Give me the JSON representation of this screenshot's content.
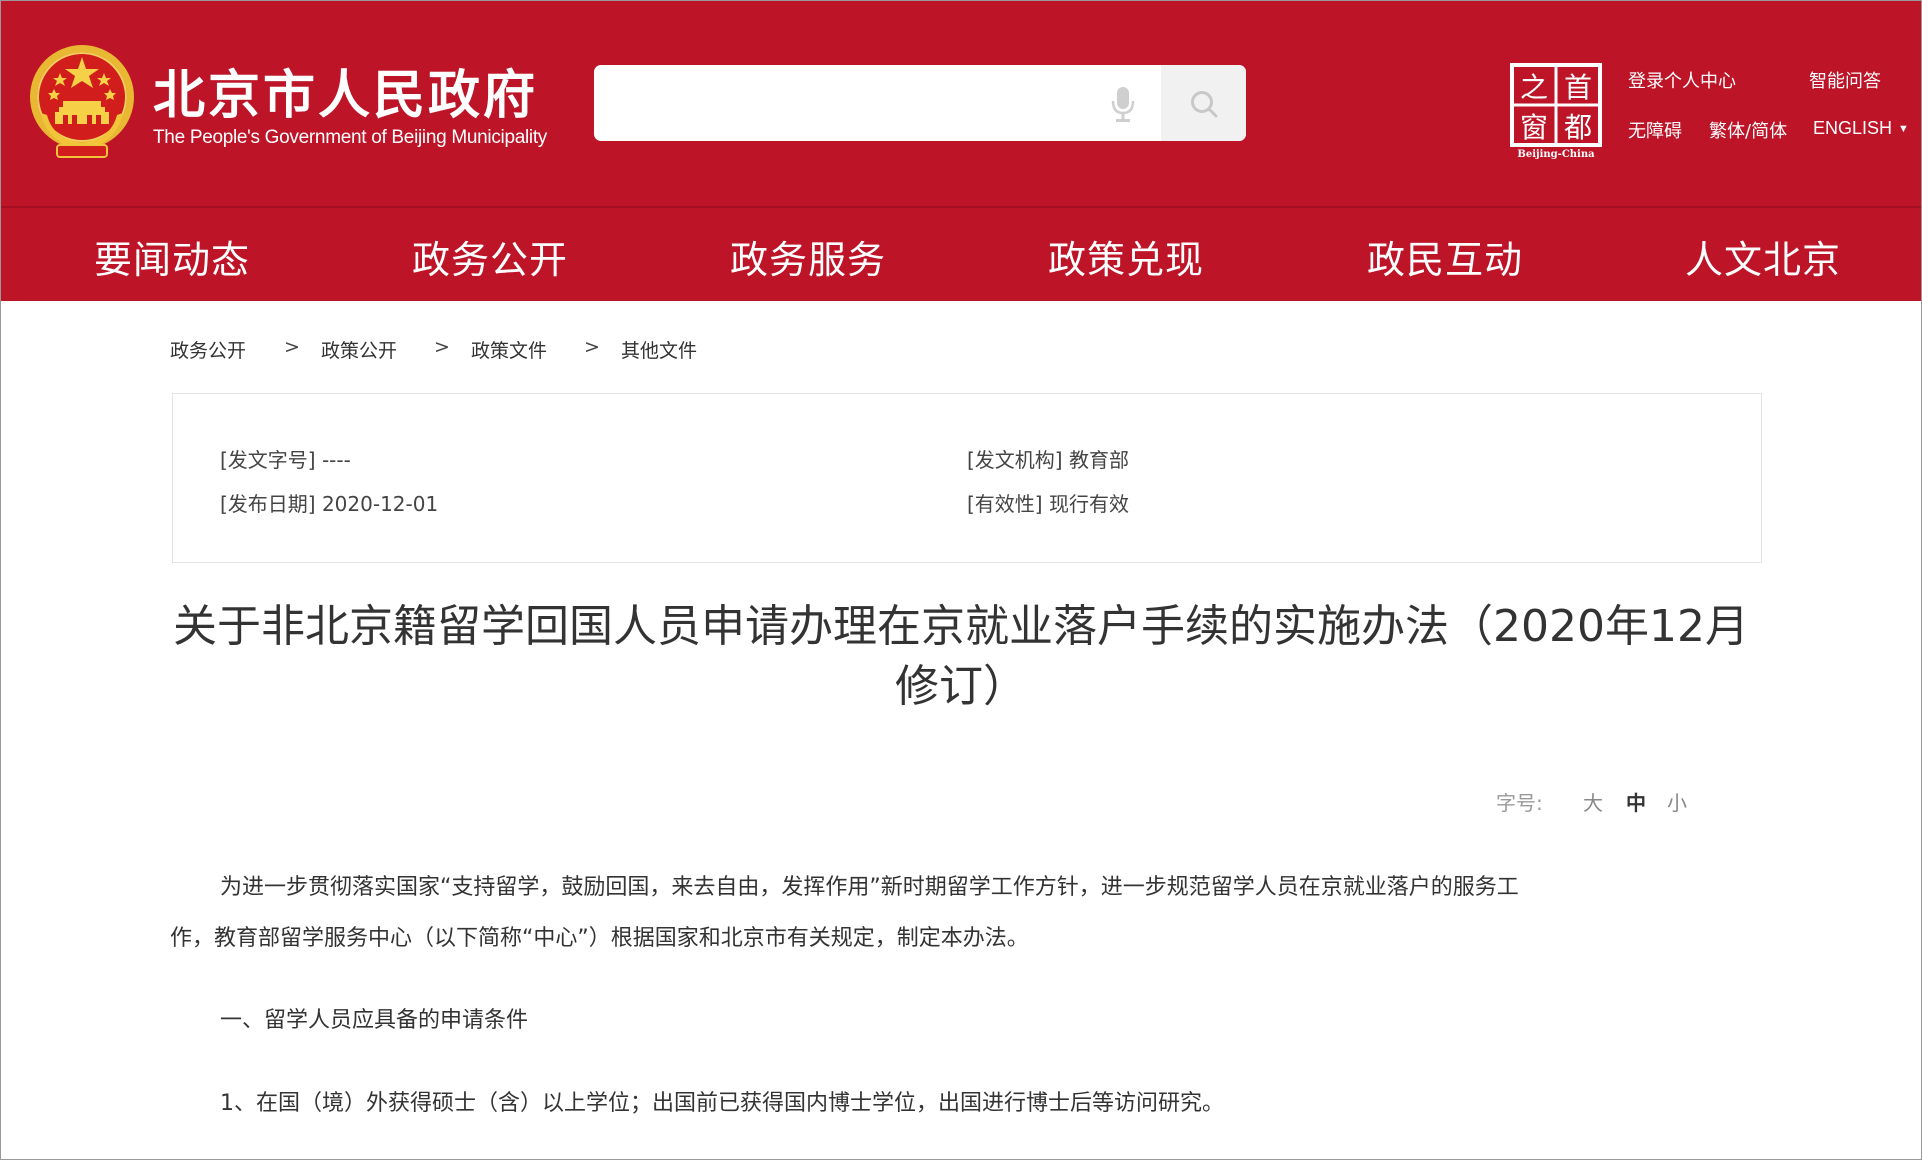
{
  "header": {
    "site_title": "北京市人民政府",
    "site_subtitle": "The People's Government of Beijing Municipality",
    "search_placeholder": "",
    "capital_logo": {
      "chars": [
        "之",
        "首",
        "窗",
        "都"
      ],
      "caption": "Beijing-China"
    },
    "links": {
      "login": "登录个人中心",
      "qa": "智能问答",
      "accessibility": "无障碍",
      "traditional": "繁体/简体",
      "english": "ENGLISH"
    },
    "icons": {
      "mic": "microphone-icon",
      "search": "search-icon",
      "emblem": "national-emblem-icon",
      "caret": "caret-down-icon"
    },
    "colors": {
      "brand_red": "#bd1428",
      "nav_divider": "#a40f21"
    }
  },
  "nav": {
    "items": [
      {
        "label": "要闻动态"
      },
      {
        "label": "政务公开"
      },
      {
        "label": "政务服务"
      },
      {
        "label": "政策兑现"
      },
      {
        "label": "政民互动"
      },
      {
        "label": "人文北京"
      }
    ]
  },
  "breadcrumb": {
    "items": [
      "政务公开",
      "政策公开",
      "政策文件",
      "其他文件"
    ],
    "separator": ">"
  },
  "info": {
    "doc_number": "[发文字号] ----",
    "issuer": "[发文机构] 教育部",
    "publish_date": "[发布日期] 2020-12-01",
    "validity": "[有效性] 现行有效"
  },
  "article": {
    "title_line1": "关于非北京籍留学回国人员申请办理在京就业落户手续的实施办法（2020年12月",
    "title_line2": "修订）",
    "font_size": {
      "label": "字号:",
      "large": "大",
      "medium": "中",
      "small": "小",
      "selected": "中"
    },
    "paragraphs": {
      "p1_line1": "为进一步贯彻落实国家“支持留学，鼓励回国，来去自由，发挥作用”新时期留学工作方针，进一步规范留学人员在京就业落户的服务工",
      "p1_line2": "作，教育部留学服务中心（以下简称“中心”）根据国家和北京市有关规定，制定本办法。",
      "section1": "一、留学人员应具备的申请条件",
      "item1": "1、在国（境）外获得硕士（含）以上学位；出国前已获得国内博士学位，出国进行博士后等访问研究。"
    }
  }
}
